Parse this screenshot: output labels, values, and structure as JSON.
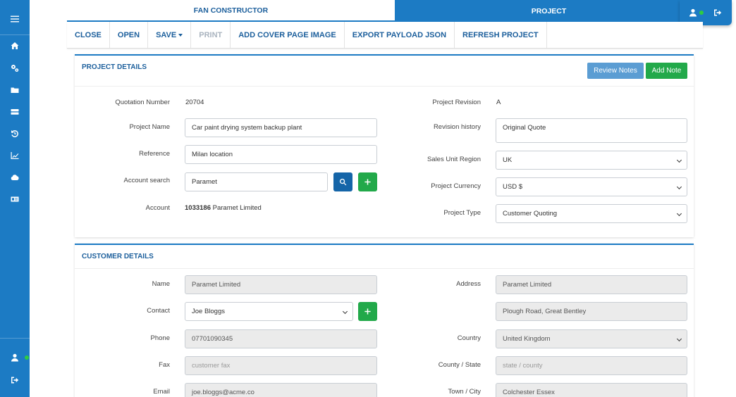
{
  "tabs": {
    "fan": "FAN CONSTRUCTOR",
    "project": "PROJECT"
  },
  "toolbar": {
    "close": "CLOSE",
    "open": "OPEN",
    "save": "SAVE",
    "print": "PRINT",
    "add_cover": "ADD COVER PAGE IMAGE",
    "export_json": "EXPORT PAYLOAD JSON",
    "refresh": "REFRESH PROJECT"
  },
  "project_details": {
    "title": "PROJECT DETAILS",
    "review_notes": "Review Notes",
    "add_note": "Add Note",
    "quotation_number_label": "Quotation Number",
    "quotation_number": "20704",
    "project_name_label": "Project Name",
    "project_name": "Car paint drying system backup plant",
    "reference_label": "Reference",
    "reference": "Milan location",
    "account_search_label": "Account search",
    "account_search": "Paramet",
    "account_label": "Account",
    "account_id": "1033186",
    "account_name": "Paramet Limited",
    "project_revision_label": "Project Revision",
    "project_revision": "A",
    "revision_history_label": "Revision history",
    "revision_history": "Original Quote",
    "sales_unit_region_label": "Sales Unit Region",
    "sales_unit_region": "UK",
    "project_currency_label": "Project Currency",
    "project_currency": "USD $",
    "project_type_label": "Project Type",
    "project_type": "Customer Quoting"
  },
  "customer_details": {
    "title": "CUSTOMER DETAILS",
    "name_label": "Name",
    "name": "Paramet Limited",
    "contact_label": "Contact",
    "contact": "Joe Bloggs",
    "phone_label": "Phone",
    "phone": "07701090345",
    "fax_label": "Fax",
    "fax_placeholder": "customer fax",
    "email_label": "Email",
    "email": "joe.bloggs@acme.co",
    "address_label": "Address",
    "address_line1": "Paramet Limited",
    "address_line2": "Plough Road, Great Bentley",
    "country_label": "Country",
    "country": "United Kingdom",
    "county_label": "County / State",
    "county_placeholder": "state / county",
    "town_label": "Town / City",
    "town": "Colchester Essex"
  },
  "colors": {
    "brand_blue": "#1c7bc4",
    "title_blue": "#1c5f9c",
    "search_button": "#1565a8",
    "review_notes_button": "#5b9dd3",
    "add_button_green": "#22a94a"
  },
  "icons": {
    "sidebar": [
      "menu-icon",
      "home-icon",
      "cogs-icon",
      "folder-icon",
      "server-icon",
      "history-icon",
      "chart-icon",
      "cloud-icon",
      "id-card-icon",
      "user-icon",
      "sign-out-icon"
    ],
    "header": [
      "user-icon",
      "sign-out-icon"
    ]
  }
}
